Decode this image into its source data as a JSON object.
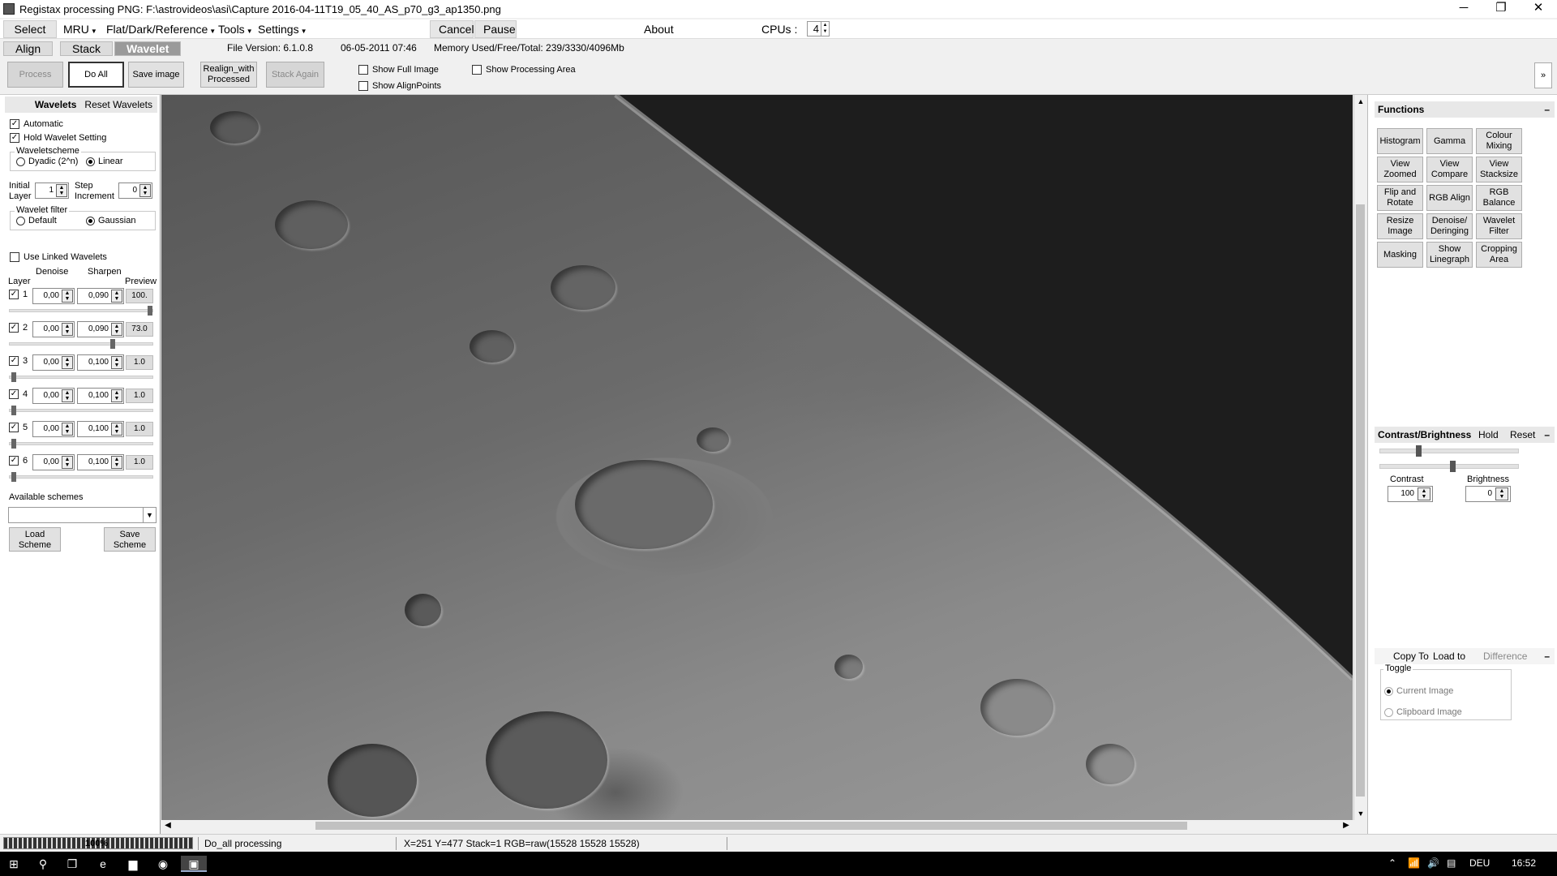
{
  "window": {
    "title": "Registax processing PNG: F:\\astrovideos\\asi\\Capture 2016-04-11T19_05_40_AS_p70_g3_ap1350.png",
    "controls": {
      "minimize": "─",
      "maximize": "❐",
      "close": "✕"
    }
  },
  "menu": {
    "select": "Select",
    "mru": "MRU",
    "flat": "Flat/Dark/Reference",
    "tools": "Tools",
    "settings": "Settings",
    "cancel": "Cancel",
    "pause": "Pause",
    "about": "About",
    "cpus_label": "CPUs :",
    "cpus_value": "4"
  },
  "tabs": {
    "align": "Align",
    "stack": "Stack",
    "wavelet": "Wavelet",
    "file_version": "File Version: 6.1.0.8",
    "file_date": "06-05-2011 07:46",
    "memory": "Memory Used/Free/Total: 239/3330/4096Mb"
  },
  "toolbar": {
    "process": "Process",
    "do_all": "Do All",
    "save_image": "Save image",
    "realign": "Realign_with Processed",
    "stack_again": "Stack Again",
    "show_full_image": "Show Full Image",
    "show_alignpoints": "Show AlignPoints",
    "show_processing_area": "Show Processing Area",
    "collapse": "»"
  },
  "wavelets": {
    "header_title": "Wavelets",
    "reset": "Reset Wavelets",
    "automatic": "Automatic",
    "hold": "Hold Wavelet Setting",
    "scheme_label": "Waveletscheme",
    "dyadic": "Dyadic (2^n)",
    "linear": "Linear",
    "initial_layer_label": "Initial Layer",
    "initial_layer_value": "1",
    "step_increment_label": "Step Increment",
    "step_increment_value": "0",
    "filter_label": "Wavelet filter",
    "default": "Default",
    "gaussian": "Gaussian",
    "use_linked": "Use Linked Wavelets",
    "col_layer": "Layer",
    "col_denoise": "Denoise",
    "col_sharpen": "Sharpen",
    "col_preview": "Preview",
    "layers": [
      {
        "n": "1",
        "denoise": "0,00",
        "sharpen": "0,090",
        "preview": "100.",
        "level": 1.0
      },
      {
        "n": "2",
        "denoise": "0,00",
        "sharpen": "0,090",
        "preview": "73.0",
        "level": 0.73
      },
      {
        "n": "3",
        "denoise": "0,00",
        "sharpen": "0,100",
        "preview": "1.0",
        "level": 0.01
      },
      {
        "n": "4",
        "denoise": "0,00",
        "sharpen": "0,100",
        "preview": "1.0",
        "level": 0.01
      },
      {
        "n": "5",
        "denoise": "0,00",
        "sharpen": "0,100",
        "preview": "1.0",
        "level": 0.01
      },
      {
        "n": "6",
        "denoise": "0,00",
        "sharpen": "0,100",
        "preview": "1.0",
        "level": 0.01
      }
    ],
    "available_schemes": "Available schemes",
    "load_scheme": "Load Scheme",
    "save_scheme": "Save Scheme"
  },
  "functions": {
    "header": "Functions",
    "buttons": [
      "Histogram",
      "Gamma",
      "Colour Mixing",
      "View Zoomed",
      "View Compare",
      "View Stacksize",
      "Flip and Rotate",
      "RGB Align",
      "RGB Balance",
      "Resize Image",
      "Denoise/ Deringing",
      "Wavelet Filter",
      "Masking",
      "Show Linegraph",
      "Cropping Area"
    ]
  },
  "contrast": {
    "header": "Contrast/Brightness",
    "hold": "Hold",
    "reset": "Reset",
    "contrast_label": "Contrast",
    "contrast_value": "100",
    "brightness_label": "Brightness",
    "brightness_value": "0"
  },
  "copy": {
    "copy_to": "Copy To",
    "load_to": "Load to",
    "difference": "Difference",
    "toggle": "Toggle",
    "current_image": "Current Image",
    "clipboard_image": "Clipboard Image"
  },
  "status": {
    "progress": "100%",
    "progress_level": 1.0,
    "task": "Do_all processing",
    "coords": "X=251 Y=477 Stack=1 RGB=raw(15528 15528 15528)"
  },
  "taskbar": {
    "lang": "DEU",
    "time": "16:52"
  }
}
